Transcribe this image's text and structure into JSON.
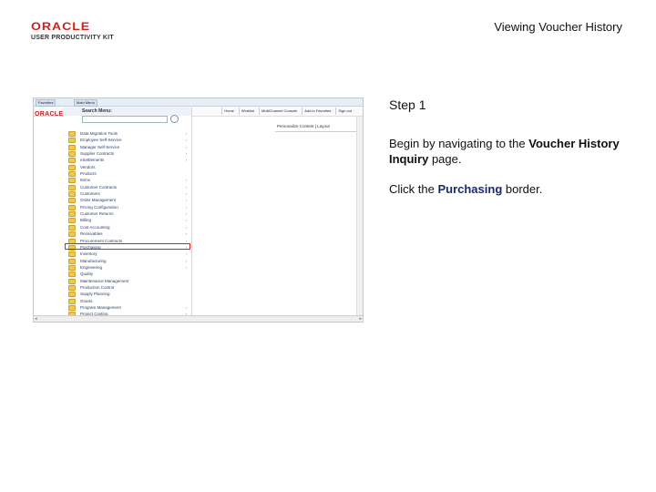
{
  "logo": {
    "brand": "ORACLE",
    "subtitle": "USER PRODUCTIVITY KIT"
  },
  "header": {
    "title": "Viewing Voucher History"
  },
  "screenshot": {
    "tabs": [
      "Favorites",
      "Main Menu"
    ],
    "brand": "ORACLE",
    "nav_links": [
      "Home",
      "Worklist",
      "MultiChannel Console",
      "Add to Favorites",
      "Sign out"
    ],
    "menu_title": "Search Menu:",
    "personalize": "Personalize Content | Layout",
    "menu_items": [
      "Data Migration Tools",
      "Employee Self-Service",
      "Manager Self-Service",
      "Supplier Contracts",
      "eSettlements",
      "Vendors",
      "Products",
      "Items",
      "Customer Contracts",
      "Customers",
      "Order Management",
      "Pricing Configuration",
      "Customer Returns",
      "Billing",
      "Cost Accounting",
      "Receivables",
      "Procurement Contracts",
      "Purchasing",
      "Inventory",
      "Manufacturing",
      "Engineering",
      "Quality",
      "Maintenance Management",
      "Production Control",
      "Supply Planning",
      "Grants",
      "Program Management",
      "Project Costing"
    ]
  },
  "instructions": {
    "step": "Step 1",
    "line1_prefix": "Begin by navigating to the ",
    "line1_bold": "Voucher History Inquiry",
    "line1_suffix": " page.",
    "line2_prefix": "Click the ",
    "line2_bold": "Purchasing",
    "line2_suffix": " border."
  },
  "colors": {
    "brand_red": "#d21f1f",
    "highlight_red": "#e41e1e",
    "link_blue": "#1a2a6c"
  }
}
